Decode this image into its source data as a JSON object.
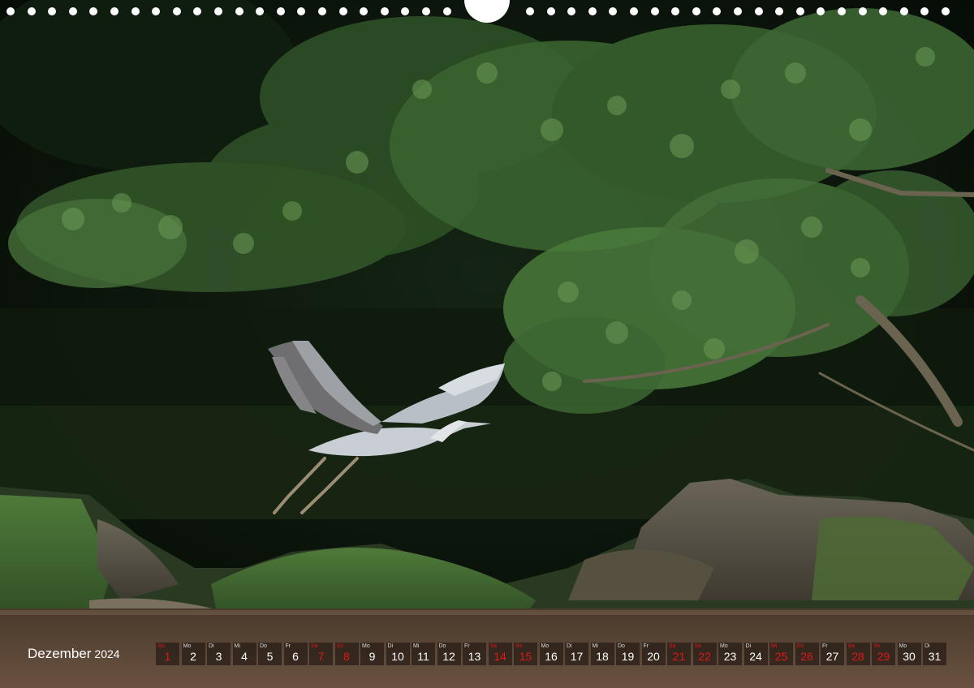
{
  "calendar": {
    "month": "Dezember",
    "year": "2024",
    "days": [
      {
        "num": "1",
        "wd": "So",
        "red": true
      },
      {
        "num": "2",
        "wd": "Mo",
        "red": false
      },
      {
        "num": "3",
        "wd": "Di",
        "red": false
      },
      {
        "num": "4",
        "wd": "Mi",
        "red": false
      },
      {
        "num": "5",
        "wd": "Do",
        "red": false
      },
      {
        "num": "6",
        "wd": "Fr",
        "red": false
      },
      {
        "num": "7",
        "wd": "Sa",
        "red": true
      },
      {
        "num": "8",
        "wd": "So",
        "red": true
      },
      {
        "num": "9",
        "wd": "Mo",
        "red": false
      },
      {
        "num": "10",
        "wd": "Di",
        "red": false
      },
      {
        "num": "11",
        "wd": "Mi",
        "red": false
      },
      {
        "num": "12",
        "wd": "Do",
        "red": false
      },
      {
        "num": "13",
        "wd": "Fr",
        "red": false
      },
      {
        "num": "14",
        "wd": "Sa",
        "red": true
      },
      {
        "num": "15",
        "wd": "So",
        "red": true
      },
      {
        "num": "16",
        "wd": "Mo",
        "red": false
      },
      {
        "num": "17",
        "wd": "Di",
        "red": false
      },
      {
        "num": "18",
        "wd": "Mi",
        "red": false
      },
      {
        "num": "19",
        "wd": "Do",
        "red": false
      },
      {
        "num": "20",
        "wd": "Fr",
        "red": false
      },
      {
        "num": "21",
        "wd": "Sa",
        "red": true
      },
      {
        "num": "22",
        "wd": "So",
        "red": true
      },
      {
        "num": "23",
        "wd": "Mo",
        "red": false
      },
      {
        "num": "24",
        "wd": "Di",
        "red": false
      },
      {
        "num": "25",
        "wd": "Mi",
        "red": true
      },
      {
        "num": "26",
        "wd": "Do",
        "red": true
      },
      {
        "num": "27",
        "wd": "Fr",
        "red": false
      },
      {
        "num": "28",
        "wd": "Sa",
        "red": true
      },
      {
        "num": "29",
        "wd": "So",
        "red": true
      },
      {
        "num": "30",
        "wd": "Mo",
        "red": false
      },
      {
        "num": "31",
        "wd": "Di",
        "red": false
      }
    ]
  },
  "colors": {
    "holiday_red": "#e01818",
    "foliage_dark": "#0c1a0c",
    "foliage_light": "#4f7a3e",
    "water": "#5a4636"
  },
  "photo": {
    "subject": "heron-in-flight"
  }
}
